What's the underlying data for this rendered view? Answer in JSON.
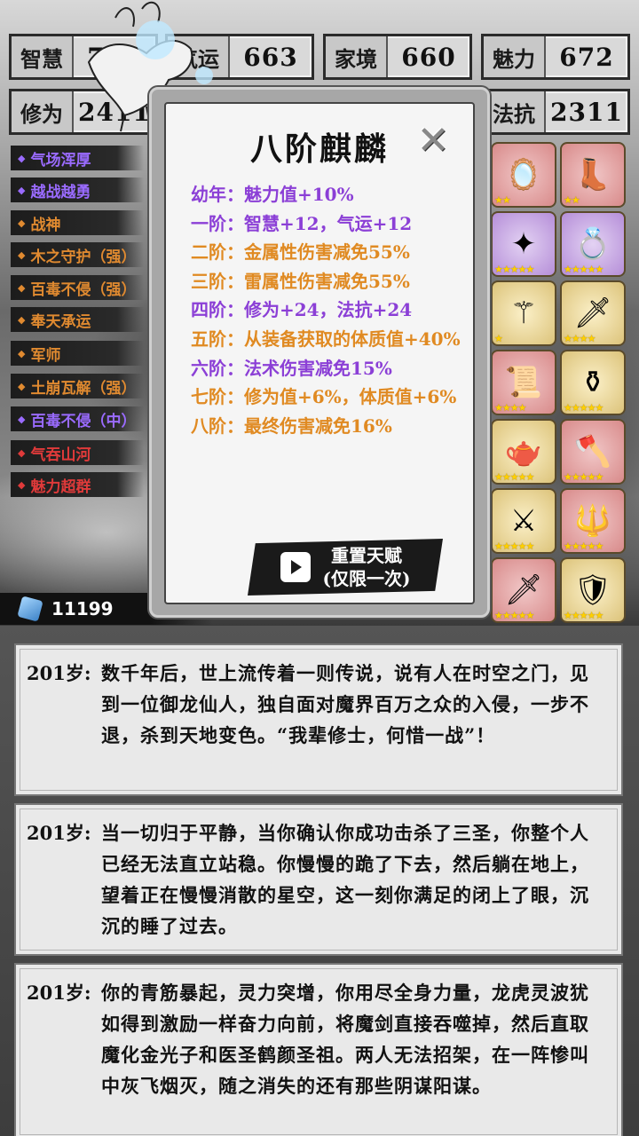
{
  "stats": [
    {
      "label": "智慧",
      "value": "728"
    },
    {
      "label": "气运",
      "value": "663"
    },
    {
      "label": "家境",
      "value": "660"
    },
    {
      "label": "魅力",
      "value": "672"
    },
    {
      "label": "修为",
      "value": "2411"
    },
    {
      "label": "法抗",
      "value": "2311"
    }
  ],
  "talents": [
    {
      "name": "气场浑厚",
      "color": "purple"
    },
    {
      "name": "越战越勇",
      "color": "purple"
    },
    {
      "name": "战神",
      "color": "orange"
    },
    {
      "name": "木之守护（强）",
      "color": "orange"
    },
    {
      "name": "百毒不侵（强）",
      "color": "orange"
    },
    {
      "name": "奉天承运",
      "color": "orange"
    },
    {
      "name": "军师",
      "color": "orange"
    },
    {
      "name": "土崩瓦解（强）",
      "color": "orange"
    },
    {
      "name": "百毒不侵（中）",
      "color": "purple"
    },
    {
      "name": "气吞山河",
      "color": "red"
    },
    {
      "name": "魅力超群",
      "color": "red"
    }
  ],
  "currency": {
    "amount": "11199",
    "icon": "gem-icon"
  },
  "popup": {
    "title": "八阶麒麟",
    "close_icon": "close-icon",
    "stages": [
      {
        "text": "幼年：魅力值+10%",
        "color": "purple"
      },
      {
        "text": "一阶：智慧+12，气运+12",
        "color": "purple"
      },
      {
        "text": "二阶：金属性伤害减免55%",
        "color": "orange"
      },
      {
        "text": "三阶：雷属性伤害减免55%",
        "color": "orange"
      },
      {
        "text": "四阶：修为+24，法抗+24",
        "color": "purple"
      },
      {
        "text": "五阶：从装备获取的体质值+40%",
        "color": "orange"
      },
      {
        "text": "六阶：法术伤害减免15%",
        "color": "purple"
      },
      {
        "text": "七阶：修为值+6%，体质值+6%",
        "color": "orange"
      },
      {
        "text": "八阶：最终伤害减免16%",
        "color": "orange"
      }
    ],
    "reset_line1": "重置天赋",
    "reset_line2": "(仅限一次)"
  },
  "items": [
    {
      "icon": "mirror-icon",
      "rarity": "red",
      "stars": "★★"
    },
    {
      "icon": "boots-icon",
      "rarity": "red",
      "stars": "★★"
    },
    {
      "icon": "amulet-icon",
      "rarity": "purple",
      "stars": "★★★★★"
    },
    {
      "icon": "ring-icon",
      "rarity": "purple",
      "stars": "★★★★★"
    },
    {
      "icon": "scepter-icon",
      "rarity": "gold",
      "stars": "★"
    },
    {
      "icon": "dagger-icon",
      "rarity": "gold",
      "stars": "★★★★"
    },
    {
      "icon": "scroll-icon",
      "rarity": "red",
      "stars": "★★★★"
    },
    {
      "icon": "cauldron-icon",
      "rarity": "gold",
      "stars": "★★★★★"
    },
    {
      "icon": "teapot-icon",
      "rarity": "gold",
      "stars": "★★★★★"
    },
    {
      "icon": "axe-icon",
      "rarity": "red",
      "stars": "★★★★★"
    },
    {
      "icon": "sword-icon",
      "rarity": "gold",
      "stars": "★★★★★"
    },
    {
      "icon": "spear-icon",
      "rarity": "red",
      "stars": "★★★★★"
    },
    {
      "icon": "greatsword-icon",
      "rarity": "red",
      "stars": "★★★★★"
    },
    {
      "icon": "armor-icon",
      "rarity": "gold",
      "stars": "★★★★★"
    }
  ],
  "logs": [
    {
      "age": "201岁:",
      "text": "数千年后，世上流传着一则传说，说有人在时空之门，见到一位御龙仙人，独自面对魔界百万之众的入侵，一步不退，杀到天地变色。“我辈修士，何惜一战”！"
    },
    {
      "age": "201岁:",
      "text": "当一切归于平静，当你确认你成功击杀了三圣，你整个人已经无法直立站稳。你慢慢的跪了下去，然后躺在地上，望着正在慢慢消散的星空，这一刻你满足的闭上了眼，沉沉的睡了过去。"
    },
    {
      "age": "201岁:",
      "text": "你的青筋暴起，灵力突增，你用尽全身力量，龙虎灵波犹如得到激励一样奋力向前，将魔剑直接吞噬掉，然后直取魔化金光子和医圣鹤颜圣祖。两人无法招架，在一阵惨叫中灰飞烟灭，随之消失的还有那些阴谋阳谋。"
    }
  ]
}
